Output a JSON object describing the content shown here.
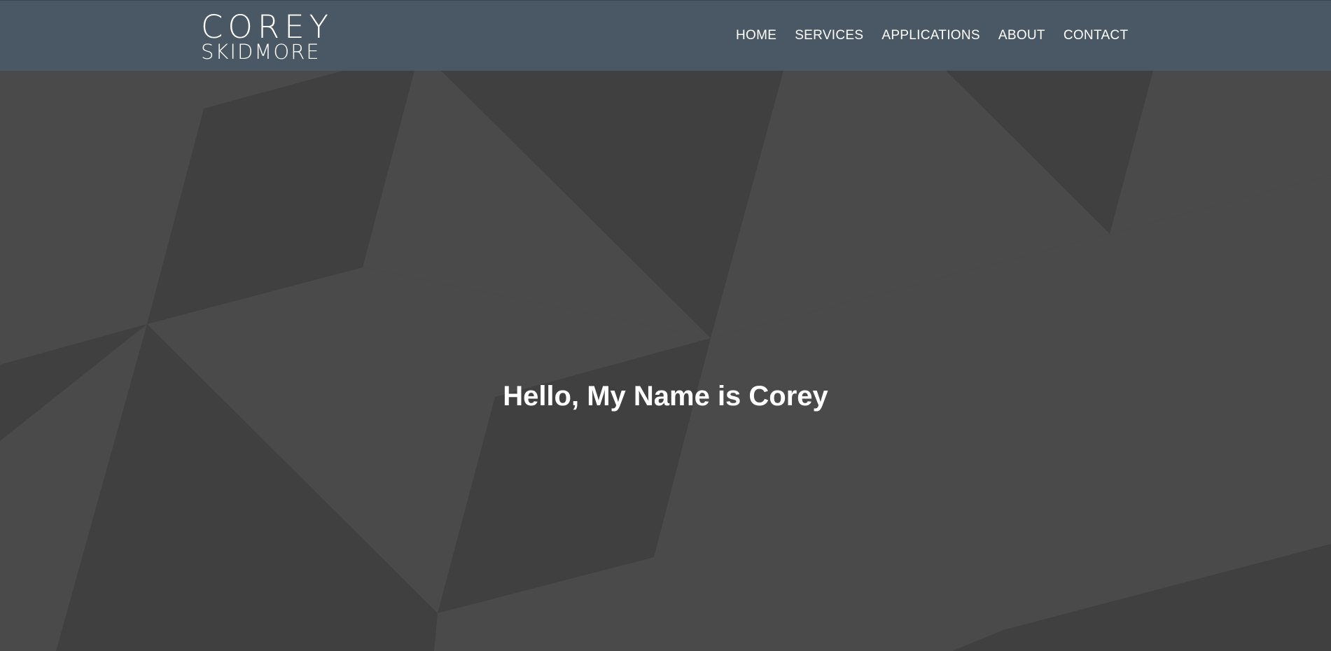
{
  "brand": {
    "line1": "COREY",
    "line2": "SKIDMORE"
  },
  "nav": {
    "items": [
      {
        "label": "HOME"
      },
      {
        "label": "SERVICES"
      },
      {
        "label": "APPLICATIONS"
      },
      {
        "label": "ABOUT"
      },
      {
        "label": "CONTACT"
      }
    ]
  },
  "hero": {
    "title": "Hello, My Name is Corey",
    "background_pattern": "geometric-triangles"
  },
  "colors": {
    "header_bg": "#4a5866",
    "hero_dark": "#404040",
    "hero_light": "#4a4a4a",
    "text": "#ffffff"
  }
}
